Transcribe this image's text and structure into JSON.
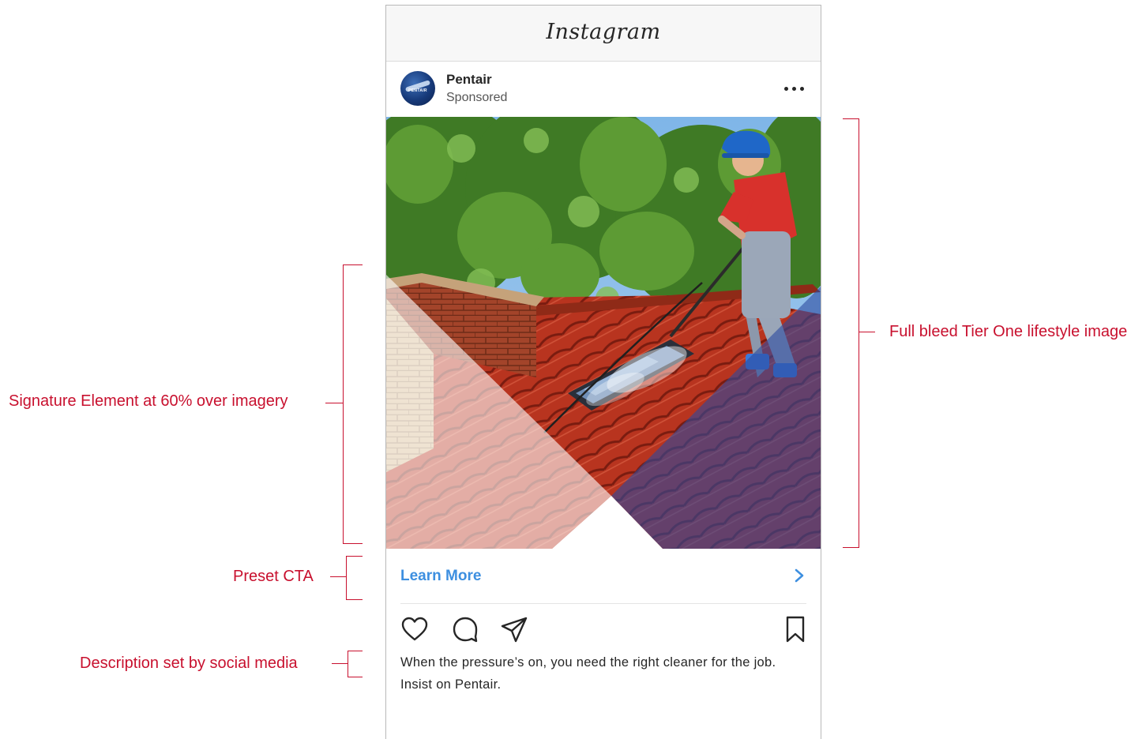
{
  "annotations": {
    "signature": "Signature Element at 60% over imagery",
    "full_bleed": "Full bleed Tier One lifestyle image",
    "preset_cta": "Preset CTA",
    "description": "Description set by social media"
  },
  "app": {
    "title": "Instagram"
  },
  "post": {
    "account_name": "Pentair",
    "sponsored_label": "Sponsored",
    "avatar_text": "PENTAIR",
    "cta_label": "Learn More",
    "caption": "When the pressure’s on, you need the right cleaner for the job. Insist on Pentair."
  },
  "icons": {
    "more": "more-options-icon",
    "chevron": "chevron-right-icon",
    "like": "heart-icon",
    "comment": "comment-icon",
    "share": "send-icon",
    "save": "bookmark-icon"
  },
  "colors": {
    "annotation": "#c8102e",
    "cta_blue": "#3d8fe0",
    "overlay_blue": "#2b4a9e",
    "overlay_white": "#ffffff"
  },
  "overlay_opacity": 0.6
}
